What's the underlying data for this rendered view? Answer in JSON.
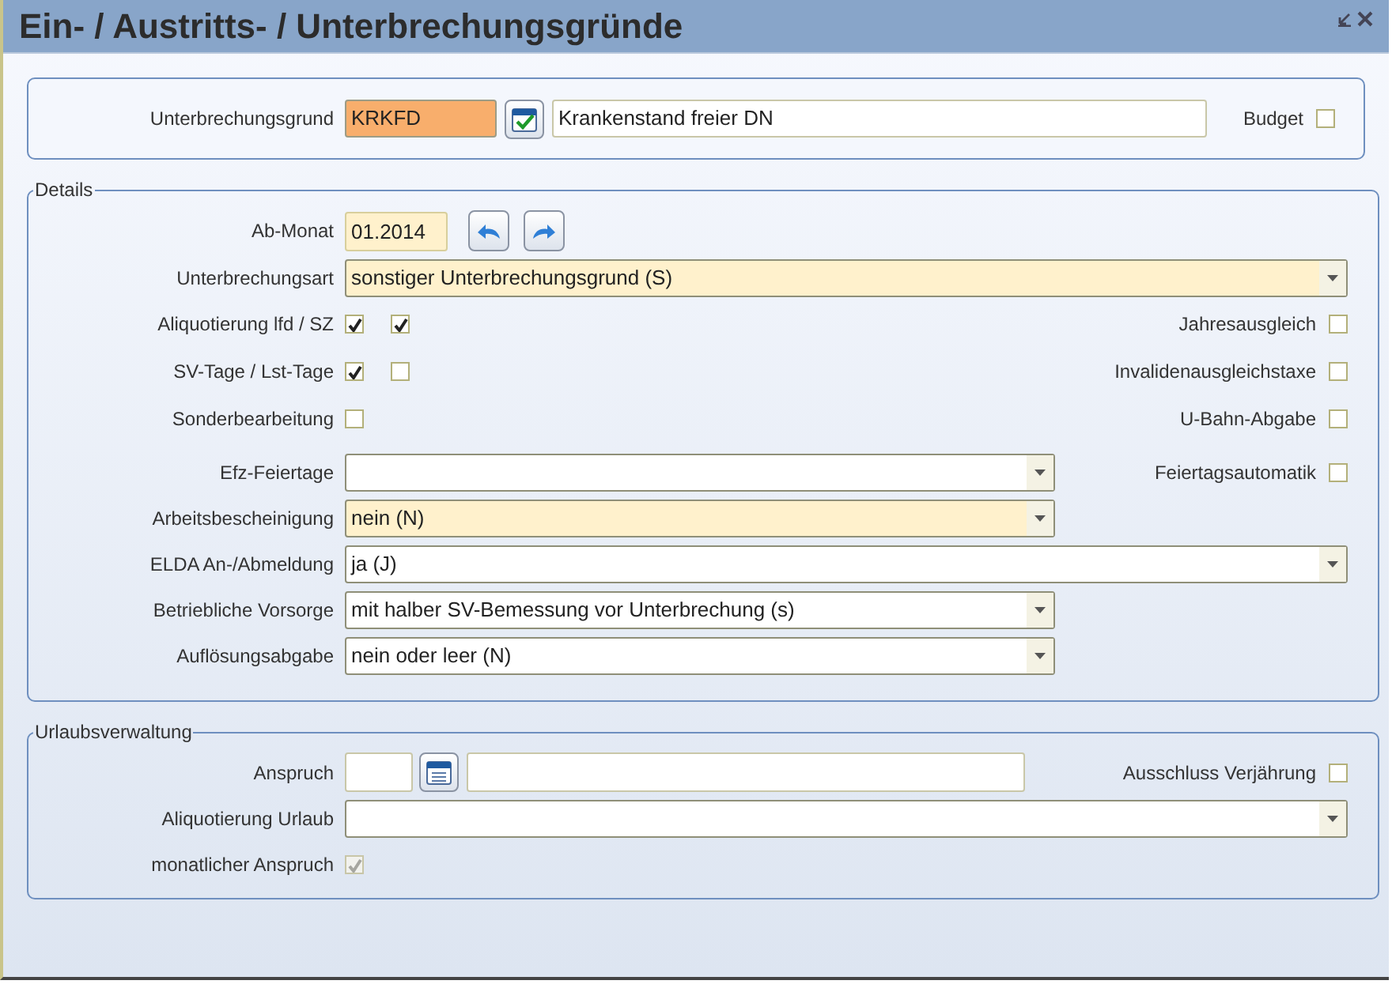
{
  "window": {
    "title": "Ein- / Austritts- / Unterbrechungsgründe"
  },
  "header": {
    "label": "Unterbrechungsgrund",
    "code": {
      "value": "KRKFD",
      "focused": true
    },
    "description": "Krankenstand freier DN",
    "budget": {
      "label": "Budget",
      "checked": false
    }
  },
  "details": {
    "legend": "Details",
    "rows": [
      {
        "kind": "month",
        "label": "Ab-Monat",
        "value": "01.2014",
        "required": true
      },
      {
        "kind": "wide_select",
        "label": "Unterbrechungsart",
        "value": "sonstiger Unterbrechungsgrund (S)",
        "required": true
      },
      {
        "kind": "checks",
        "label": "Aliquotierung lfd / SZ",
        "checks": [
          {
            "checked": true,
            "disabled": false
          },
          {
            "checked": true,
            "disabled": false
          }
        ],
        "side": {
          "label": "Jahresausgleich",
          "checked": false
        }
      },
      {
        "kind": "checks",
        "label": "SV-Tage / Lst-Tage",
        "checks": [
          {
            "checked": true,
            "disabled": false
          },
          {
            "checked": false,
            "disabled": false
          }
        ],
        "side": {
          "label": "Invalidenausgleichstaxe",
          "checked": false
        }
      },
      {
        "kind": "checks",
        "label": "Sonderbearbeitung",
        "checks": [
          {
            "checked": false,
            "disabled": false
          }
        ],
        "side": {
          "label": "U-Bahn-Abgabe",
          "checked": false
        }
      },
      {
        "kind": "select",
        "label": "Efz-Feiertage",
        "required": false,
        "side": {
          "label": "Feiertagsautomatik",
          "checked": false
        }
      },
      {
        "kind": "select",
        "label": "Arbeitsbescheinigung",
        "value": "nein (N)",
        "required": true
      },
      {
        "kind": "wide_select",
        "label": "ELDA An-/Abmeldung",
        "value": "ja (J)",
        "required": false
      },
      {
        "kind": "select",
        "label": "Betriebliche Vorsorge",
        "value": "mit halber SV-Bemessung vor Unterbrechung (s)",
        "required": false
      },
      {
        "kind": "select",
        "label": "Auflösungsabgabe",
        "value": "nein oder leer (N)",
        "required": false
      }
    ]
  },
  "vacation": {
    "legend": "Urlaubsverwaltung",
    "rows": [
      {
        "kind": "entitlement",
        "label": "Anspruch",
        "side": {
          "label": "Ausschluss Verjährung",
          "checked": false
        }
      },
      {
        "kind": "wide_select",
        "label": "Aliquotierung Urlaub",
        "required": false
      },
      {
        "kind": "checks",
        "label": "monatlicher Anspruch",
        "checks": [
          {
            "checked": true,
            "disabled": true
          }
        ]
      }
    ]
  }
}
